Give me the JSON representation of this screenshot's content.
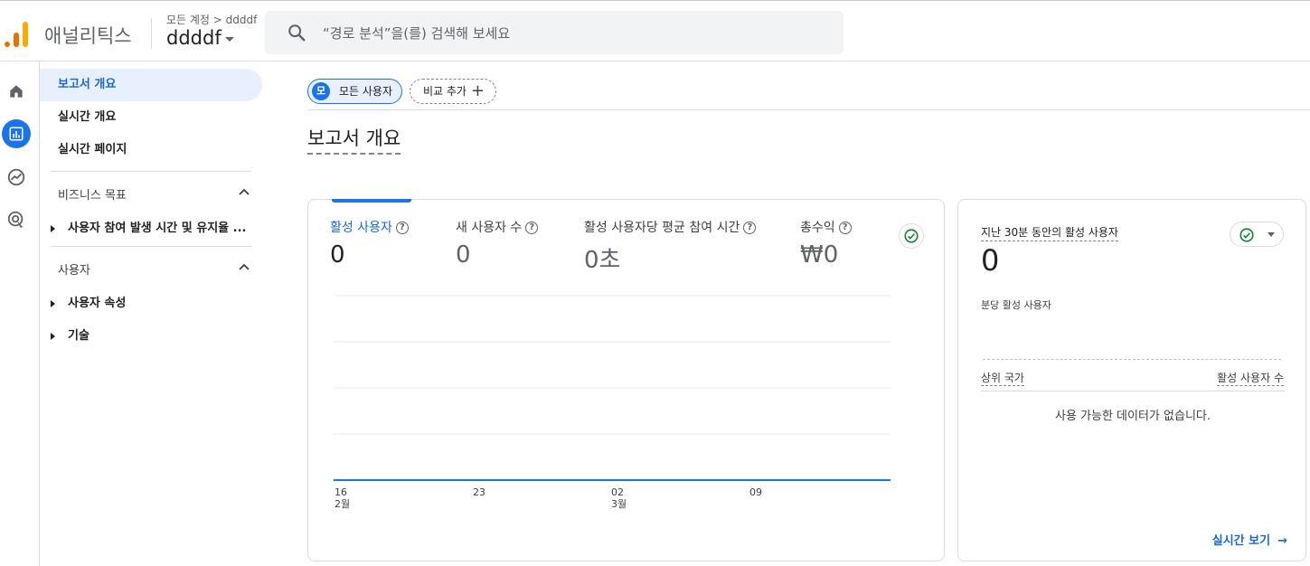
{
  "header": {
    "app_name": "애널리틱스",
    "breadcrumb": "모든 계정 > ddddf",
    "account_name": "ddddf",
    "search_placeholder": "“경로 분석”을(를) 검색해 보세요"
  },
  "rail": {
    "items": [
      "home-icon",
      "reports-icon",
      "explore-icon",
      "advertising-icon"
    ],
    "active": 1
  },
  "nav": {
    "items": [
      "보고서 개요",
      "실시간 개요",
      "실시간 페이지"
    ],
    "section_business": "비즈니스 목표",
    "business_items": [
      "사용자 참여 발생 시간 및 유지율 ..."
    ],
    "section_user": "사용자",
    "user_items": [
      "사용자 속성",
      "기술"
    ]
  },
  "main": {
    "chip_user_avatar": "모",
    "chip_user_label": "모든 사용자",
    "chip_add_label": "비교 추가",
    "page_title": "보고서 개요"
  },
  "metrics": [
    {
      "label": "활성 사용자",
      "value": "0"
    },
    {
      "label": "새 사용자 수",
      "value": "0"
    },
    {
      "label": "활성 사용자당 평균 참여 시간",
      "value": "0초"
    },
    {
      "label": "총수익",
      "value": "₩0"
    }
  ],
  "chart_data": {
    "type": "line",
    "x": [
      "16\n2월",
      "23",
      "02\n3월",
      "09"
    ],
    "x_labels": [
      {
        "day": "16",
        "month": "2월"
      },
      {
        "day": "23",
        "month": ""
      },
      {
        "day": "02",
        "month": "3월"
      },
      {
        "day": "09",
        "month": ""
      }
    ],
    "series": [
      {
        "values": [
          0,
          0,
          0,
          0
        ]
      }
    ],
    "grid": true,
    "color": "#1a73e8"
  },
  "realtime": {
    "title": "지난 30분 동안의 활성 사용자",
    "value": "0",
    "sub": "분당 활성 사용자",
    "col_country": "상위 국가",
    "col_users": "활성 사용자 수",
    "empty": "사용 가능한 데이터가 없습니다.",
    "link": "실시간 보기"
  },
  "colors": {
    "accent": "#1a73e8",
    "success": "#188038",
    "brand_orange": "#e37400",
    "brand_yellow": "#f9ab00"
  }
}
